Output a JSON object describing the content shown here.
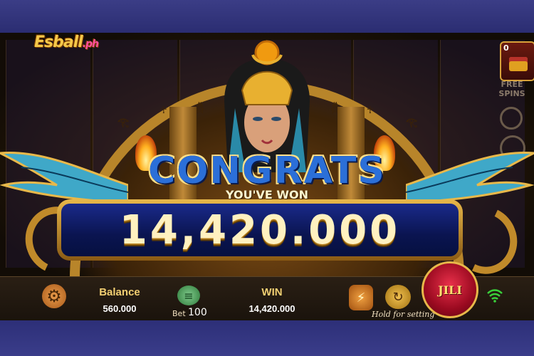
{
  "branding": {
    "logo_main": "Esball",
    "logo_suffix": ".ph"
  },
  "feature": {
    "chest_count": "0",
    "free_spins_label": "FREE SPINS"
  },
  "win_popup": {
    "title": "CONGRATS",
    "subtitle": "YOU'VE WON",
    "amount": "14,420.000"
  },
  "hud": {
    "balance_label": "Balance",
    "balance_value": "560.000",
    "bet_label": "Bet",
    "bet_value": "100",
    "win_label": "WIN",
    "win_value": "14,420.000",
    "hold_hint": "Hold for setting",
    "spin_label": "JILI"
  },
  "icons": {
    "settings": "gear-icon",
    "bet": "coin-stack-icon",
    "turbo": "lightning-icon",
    "auto": "auto-spin-icon",
    "signal": "wifi-icon"
  },
  "colors": {
    "gold": "#e8b84a",
    "plaque_blue": "#0a1450",
    "spin_red": "#c8102e",
    "congrats_blue": "#2b6fd8",
    "wifi_green": "#3ad13a"
  }
}
